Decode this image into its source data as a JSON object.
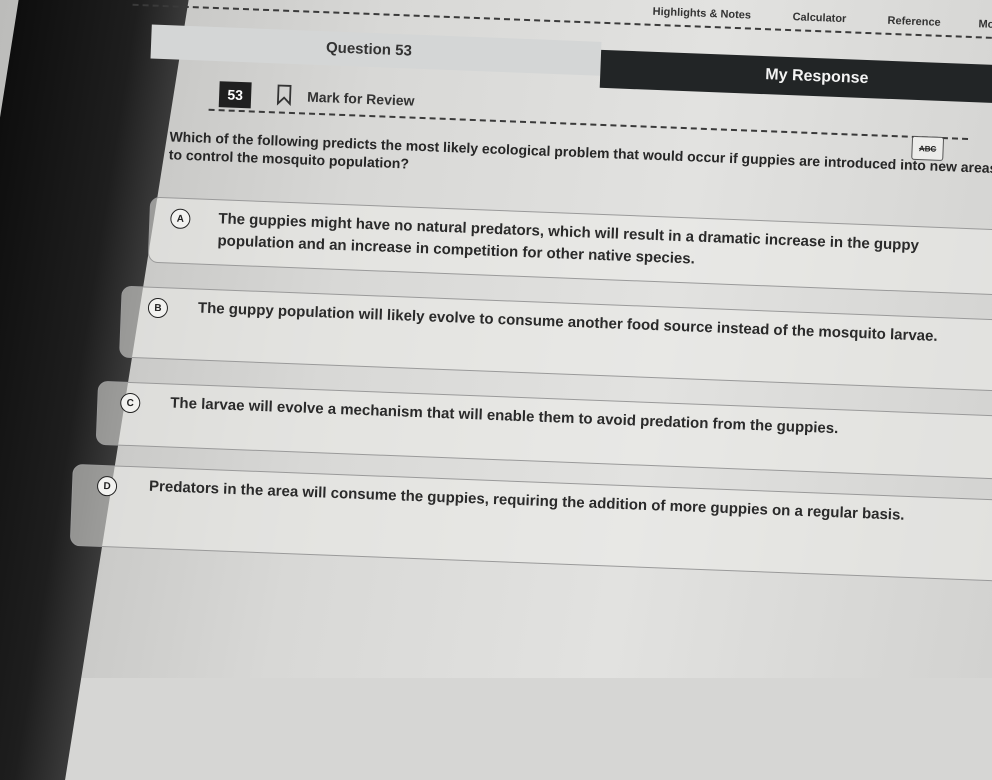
{
  "toolbar": {
    "highlights_notes": "Highlights & Notes",
    "calculator": "Calculator",
    "reference": "Reference",
    "more": "Mo"
  },
  "left_panel": {
    "title": "Question 53"
  },
  "right_panel": {
    "title": "My Response"
  },
  "question": {
    "number": "53",
    "mark_for_review": "Mark for Review",
    "abc_label": "ABC",
    "text": "Which of the following predicts the most likely ecological problem that would occur if guppies are introduced into new areas to control the mosquito population?"
  },
  "options": [
    {
      "letter": "A",
      "text": "The guppies might have no natural predators, which will result in a dramatic increase in the guppy population and an increase in competition for other native species."
    },
    {
      "letter": "B",
      "text": "The guppy population will likely evolve to consume another food source instead of the mosquito larvae."
    },
    {
      "letter": "C",
      "text": "The larvae will evolve a mechanism that will enable them to avoid predation from the guppies."
    },
    {
      "letter": "D",
      "text": "Predators in the area will consume the guppies, requiring the addition of more guppies on a regular basis."
    }
  ],
  "icons": {
    "bookmark": "bookmark-icon",
    "strikethrough": "abc-strikethrough-icon"
  },
  "colors": {
    "response_header_bg": "#222526",
    "question_number_bg": "#202020"
  }
}
